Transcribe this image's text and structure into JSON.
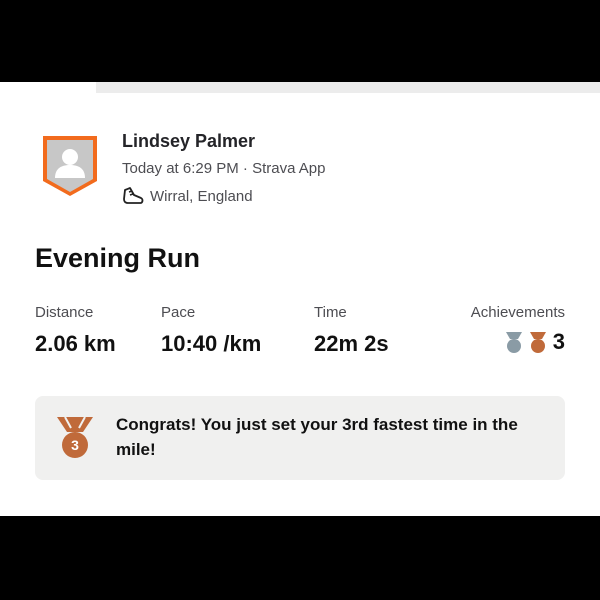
{
  "activity": {
    "user_name": "Lindsey Palmer",
    "meta": "Today at 6:29 PM · Strava App",
    "location": "Wirral, England",
    "title": "Evening Run"
  },
  "stats": {
    "distance": {
      "label": "Distance",
      "value": "2.06 km"
    },
    "pace": {
      "label": "Pace",
      "value": "10:40 /km"
    },
    "time": {
      "label": "Time",
      "value": "22m 2s"
    },
    "achievements": {
      "label": "Achievements",
      "count": "3"
    }
  },
  "banner": {
    "text": "Congrats! You just set your 3rd fastest time in the mile!",
    "medal_number": "3"
  },
  "icons": {
    "avatar": "avatar-placeholder-icon",
    "shoe": "running-shoe-icon",
    "medal_silver": "silver-medal-icon",
    "medal_bronze": "bronze-medal-icon"
  },
  "colors": {
    "accent": "#f26b1d",
    "bronze": "#c06a3a",
    "silver": "#8a9ba5",
    "avatar_bg": "#c7c7c7"
  }
}
